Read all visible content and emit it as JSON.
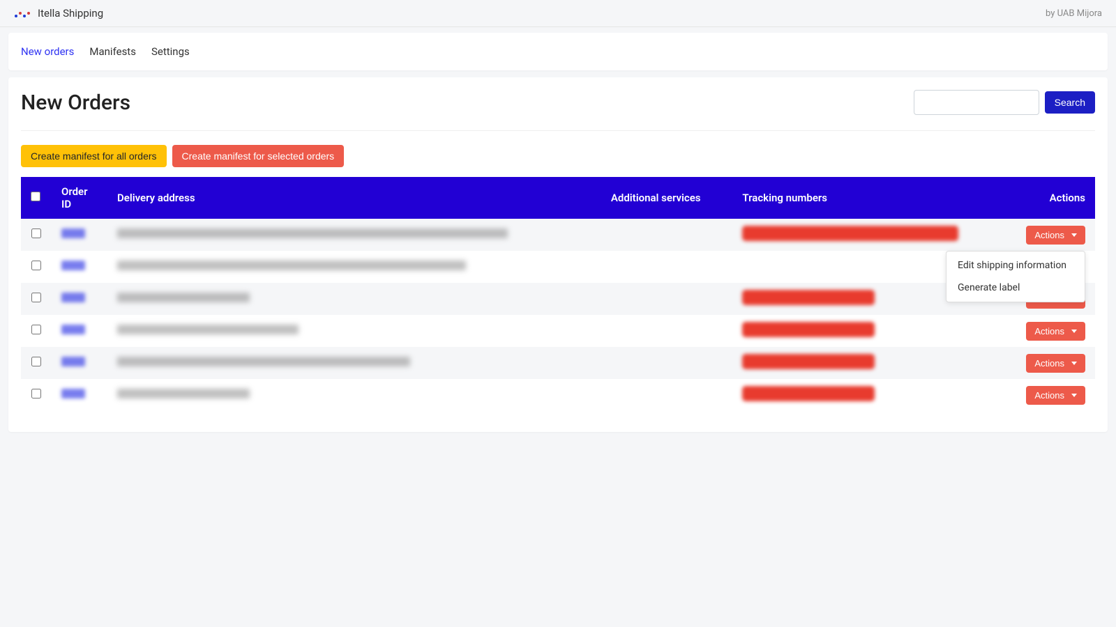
{
  "topbar": {
    "title": "Itella Shipping",
    "vendor": "by UAB Mijora"
  },
  "nav": {
    "items": [
      {
        "label": "New orders",
        "active": true
      },
      {
        "label": "Manifests",
        "active": false
      },
      {
        "label": "Settings",
        "active": false
      }
    ]
  },
  "page": {
    "title": "New Orders",
    "search_button": "Search"
  },
  "toolbar": {
    "create_all": "Create manifest for all orders",
    "create_selected": "Create manifest for selected orders"
  },
  "table": {
    "headers": {
      "order_id": "Order ID",
      "delivery": "Delivery address",
      "services": "Additional services",
      "tracking": "Tracking numbers",
      "actions": "Actions"
    },
    "actions_label": "Actions",
    "dropdown": {
      "edit": "Edit shipping information",
      "generate": "Generate label"
    },
    "rows": [
      {
        "addr_width": 560,
        "track_width": 310,
        "dropdown_open": true
      },
      {
        "addr_width": 500,
        "track_width": 0,
        "dropdown_open": false
      },
      {
        "addr_width": 190,
        "track_width": 190,
        "dropdown_open": false
      },
      {
        "addr_width": 260,
        "track_width": 190,
        "dropdown_open": false
      },
      {
        "addr_width": 420,
        "track_width": 190,
        "dropdown_open": false
      },
      {
        "addr_width": 190,
        "track_width": 190,
        "dropdown_open": false
      }
    ]
  }
}
